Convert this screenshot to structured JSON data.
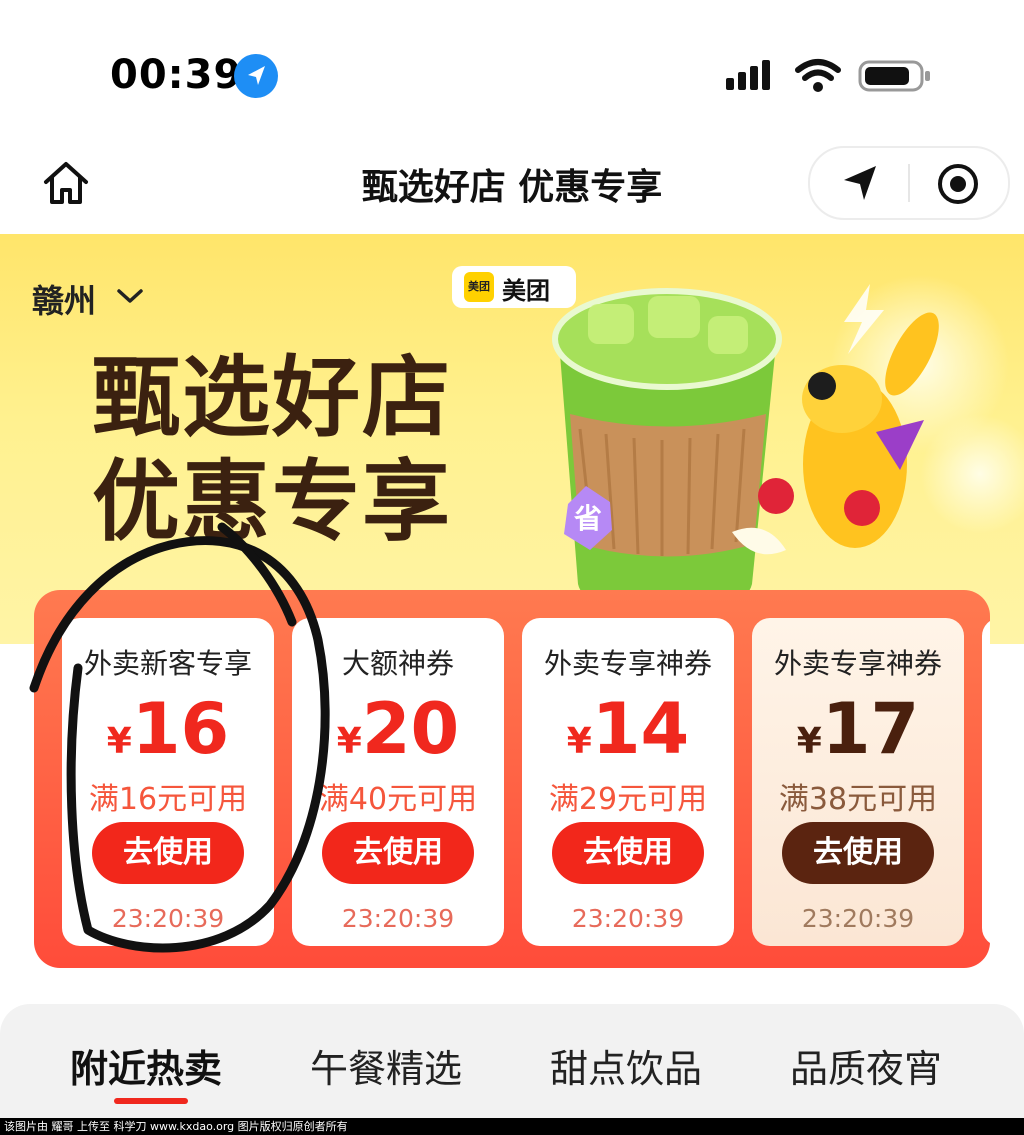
{
  "status_bar": {
    "time": "00:39"
  },
  "nav": {
    "title": "甄选好店 优惠专享"
  },
  "hero": {
    "city": "赣州",
    "brand_logo_text": "美团",
    "brand_name": "美团",
    "title_line1": "甄选好店",
    "title_line2": "优惠专享",
    "badge": "省"
  },
  "coupons": [
    {
      "title": "外卖新客专享",
      "currency": "¥",
      "amount": "16",
      "condition": "满16元可用",
      "button": "去使用",
      "timer": "23:20:39"
    },
    {
      "title": "大额神券",
      "currency": "¥",
      "amount": "20",
      "condition": "满40元可用",
      "button": "去使用",
      "timer": "23:20:39"
    },
    {
      "title": "外卖专享神券",
      "currency": "¥",
      "amount": "14",
      "condition": "满29元可用",
      "button": "去使用",
      "timer": "23:20:39"
    },
    {
      "title": "外卖专享神券",
      "currency": "¥",
      "amount": "17",
      "condition": "满38元可用",
      "button": "去使用",
      "timer": "23:20:39"
    }
  ],
  "tabs": [
    "附近热卖",
    "午餐精选",
    "甜点饮品",
    "品质夜宵"
  ],
  "footer_text": "该图片由 耀哥 上传至 科学刀 www.kxdao.org 图片版权归原创者所有",
  "colors": {
    "accent_red": "#f0281e",
    "hero_yellow": "#ffe56a",
    "strip_orange": "#ff5a3c",
    "dark_brown": "#5b2410"
  }
}
